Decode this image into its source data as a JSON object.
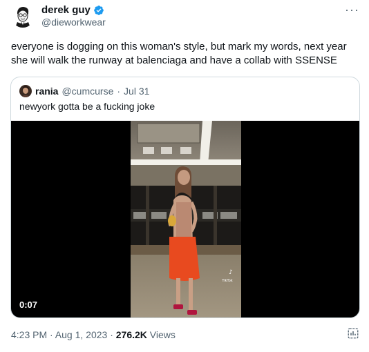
{
  "author": {
    "name": "derek guy",
    "handle": "@dieworkwear"
  },
  "tweet": {
    "text": "everyone is dogging on this woman's style, but mark my words, next year she will walk the runway at balenciaga and have a collab with SSENSE"
  },
  "quoted": {
    "name": "rania",
    "handle": "@cumcurse",
    "dot": "·",
    "date": "Jul 31",
    "text": "newyork gotta be a fucking joke",
    "video_duration": "0:07",
    "watermark": "TikTok"
  },
  "meta": {
    "time_date": "4:23 PM · Aug 1, 2023 · ",
    "views_count": "276.2K",
    "views_label": " Views"
  },
  "colors": {
    "verified": "#1d9bf0",
    "secondary_text": "#536471",
    "border": "#cfd9de"
  }
}
